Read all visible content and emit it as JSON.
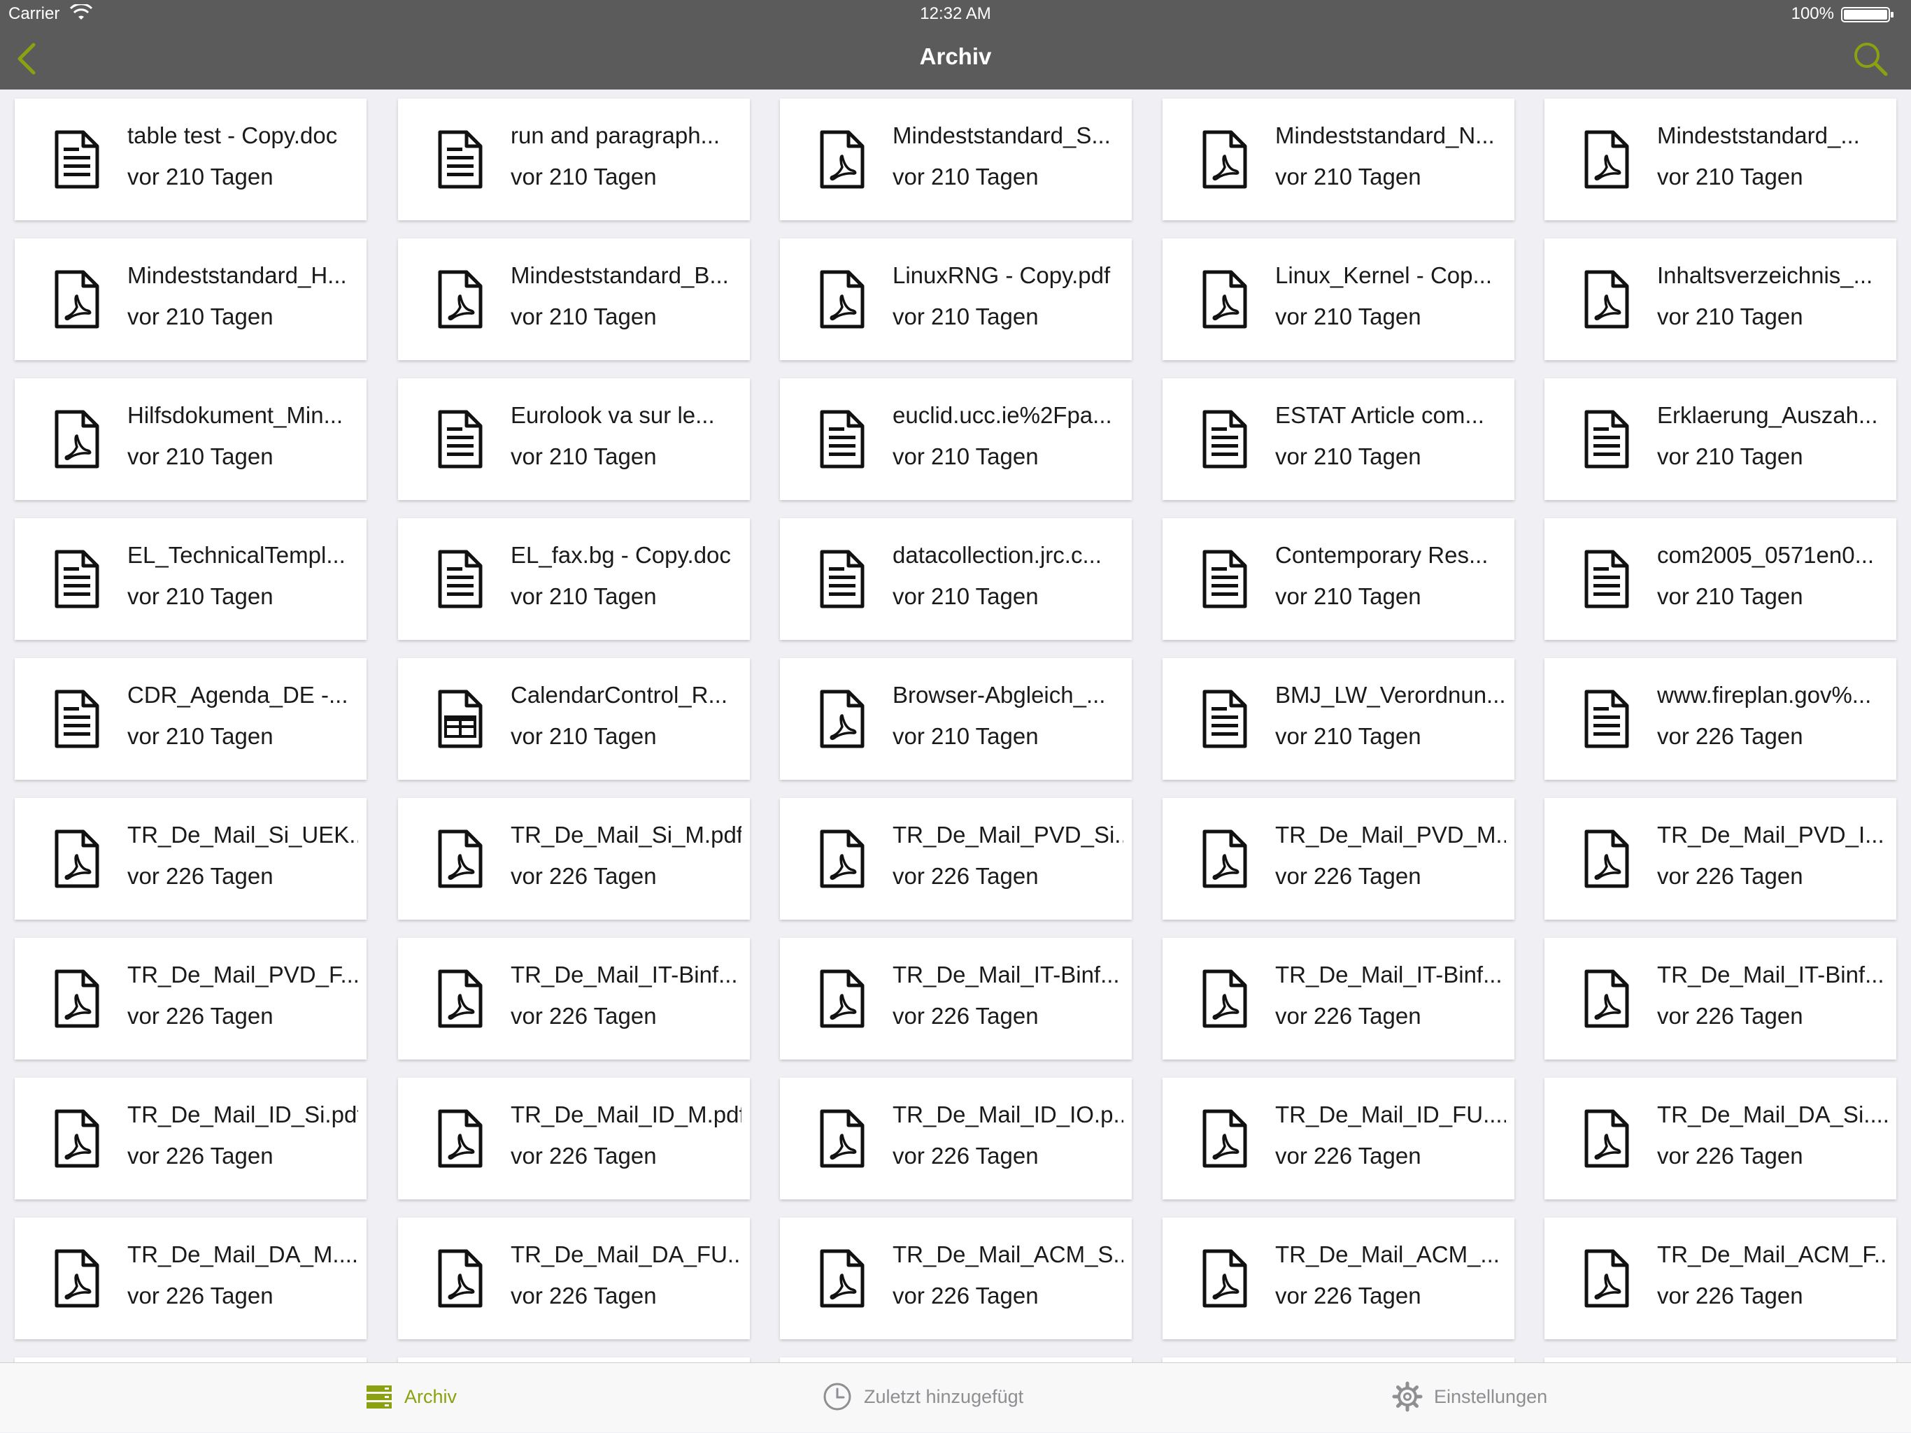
{
  "status_bar": {
    "carrier": "Carrier",
    "time": "12:32 AM",
    "battery": "100%"
  },
  "nav": {
    "title": "Archiv"
  },
  "colors": {
    "accent": "#8ca10f",
    "bar": "#5b5b5b",
    "inactive": "#8e8e93"
  },
  "files": [
    {
      "name": "table test - Copy.doc",
      "date": "vor 210 Tagen",
      "icon": "document-icon"
    },
    {
      "name": "run and paragraph...",
      "date": "vor 210 Tagen",
      "icon": "document-icon"
    },
    {
      "name": "Mindeststandard_S...",
      "date": "vor 210 Tagen",
      "icon": "pdf-icon"
    },
    {
      "name": "Mindeststandard_N...",
      "date": "vor 210 Tagen",
      "icon": "pdf-icon"
    },
    {
      "name": "Mindeststandard_...",
      "date": "vor 210 Tagen",
      "icon": "pdf-icon"
    },
    {
      "name": "Mindeststandard_H...",
      "date": "vor 210 Tagen",
      "icon": "pdf-icon"
    },
    {
      "name": "Mindeststandard_B...",
      "date": "vor 210 Tagen",
      "icon": "pdf-icon"
    },
    {
      "name": "LinuxRNG - Copy.pdf",
      "date": "vor 210 Tagen",
      "icon": "pdf-icon"
    },
    {
      "name": "Linux_Kernel - Cop...",
      "date": "vor 210 Tagen",
      "icon": "pdf-icon"
    },
    {
      "name": "Inhaltsverzeichnis_...",
      "date": "vor 210 Tagen",
      "icon": "pdf-icon"
    },
    {
      "name": "Hilfsdokument_Min...",
      "date": "vor 210 Tagen",
      "icon": "pdf-icon"
    },
    {
      "name": "Eurolook va sur le...",
      "date": "vor 210 Tagen",
      "icon": "document-icon"
    },
    {
      "name": "euclid.ucc.ie%2Fpa...",
      "date": "vor 210 Tagen",
      "icon": "document-icon"
    },
    {
      "name": "ESTAT Article com...",
      "date": "vor 210 Tagen",
      "icon": "document-icon"
    },
    {
      "name": "Erklaerung_Auszah...",
      "date": "vor 210 Tagen",
      "icon": "document-icon"
    },
    {
      "name": "EL_TechnicalTempl...",
      "date": "vor 210 Tagen",
      "icon": "document-icon"
    },
    {
      "name": "EL_fax.bg - Copy.doc",
      "date": "vor 210 Tagen",
      "icon": "document-icon"
    },
    {
      "name": "datacollection.jrc.c...",
      "date": "vor 210 Tagen",
      "icon": "document-icon"
    },
    {
      "name": "Contemporary Res...",
      "date": "vor 210 Tagen",
      "icon": "document-icon"
    },
    {
      "name": "com2005_0571en0...",
      "date": "vor 210 Tagen",
      "icon": "document-icon"
    },
    {
      "name": "CDR_Agenda_DE -...",
      "date": "vor 210 Tagen",
      "icon": "document-icon"
    },
    {
      "name": "CalendarControl_R...",
      "date": "vor 210 Tagen",
      "icon": "spreadsheet-icon"
    },
    {
      "name": "Browser-Abgleich_...",
      "date": "vor 210 Tagen",
      "icon": "pdf-icon"
    },
    {
      "name": "BMJ_LW_Verordnun...",
      "date": "vor 210 Tagen",
      "icon": "document-icon"
    },
    {
      "name": "www.fireplan.gov%...",
      "date": "vor 226 Tagen",
      "icon": "document-icon"
    },
    {
      "name": "TR_De_Mail_Si_UEK...",
      "date": "vor 226 Tagen",
      "icon": "pdf-icon"
    },
    {
      "name": "TR_De_Mail_Si_M.pdf",
      "date": "vor 226 Tagen",
      "icon": "pdf-icon"
    },
    {
      "name": "TR_De_Mail_PVD_Si...",
      "date": "vor 226 Tagen",
      "icon": "pdf-icon"
    },
    {
      "name": "TR_De_Mail_PVD_M...",
      "date": "vor 226 Tagen",
      "icon": "pdf-icon"
    },
    {
      "name": "TR_De_Mail_PVD_I...",
      "date": "vor 226 Tagen",
      "icon": "pdf-icon"
    },
    {
      "name": "TR_De_Mail_PVD_F...",
      "date": "vor 226 Tagen",
      "icon": "pdf-icon"
    },
    {
      "name": "TR_De_Mail_IT-Binf...",
      "date": "vor 226 Tagen",
      "icon": "pdf-icon"
    },
    {
      "name": "TR_De_Mail_IT-Binf...",
      "date": "vor 226 Tagen",
      "icon": "pdf-icon"
    },
    {
      "name": "TR_De_Mail_IT-Binf...",
      "date": "vor 226 Tagen",
      "icon": "pdf-icon"
    },
    {
      "name": "TR_De_Mail_IT-Binf...",
      "date": "vor 226 Tagen",
      "icon": "pdf-icon"
    },
    {
      "name": "TR_De_Mail_ID_Si.pdf",
      "date": "vor 226 Tagen",
      "icon": "pdf-icon"
    },
    {
      "name": "TR_De_Mail_ID_M.pdf",
      "date": "vor 226 Tagen",
      "icon": "pdf-icon"
    },
    {
      "name": "TR_De_Mail_ID_IO.p...",
      "date": "vor 226 Tagen",
      "icon": "pdf-icon"
    },
    {
      "name": "TR_De_Mail_ID_FU....",
      "date": "vor 226 Tagen",
      "icon": "pdf-icon"
    },
    {
      "name": "TR_De_Mail_DA_Si....",
      "date": "vor 226 Tagen",
      "icon": "pdf-icon"
    },
    {
      "name": "TR_De_Mail_DA_M....",
      "date": "vor 226 Tagen",
      "icon": "pdf-icon"
    },
    {
      "name": "TR_De_Mail_DA_FU...",
      "date": "vor 226 Tagen",
      "icon": "pdf-icon"
    },
    {
      "name": "TR_De_Mail_ACM_S...",
      "date": "vor 226 Tagen",
      "icon": "pdf-icon"
    },
    {
      "name": "TR_De_Mail_ACM_...",
      "date": "vor 226 Tagen",
      "icon": "pdf-icon"
    },
    {
      "name": "TR_De_Mail_ACM_F...",
      "date": "vor 226 Tagen",
      "icon": "pdf-icon"
    }
  ],
  "tabs": [
    {
      "label": "Archiv",
      "icon": "archive-icon",
      "active": true
    },
    {
      "label": "Zuletzt hinzugefügt",
      "icon": "clock-icon",
      "active": false
    },
    {
      "label": "Einstellungen",
      "icon": "gear-icon",
      "active": false
    }
  ]
}
